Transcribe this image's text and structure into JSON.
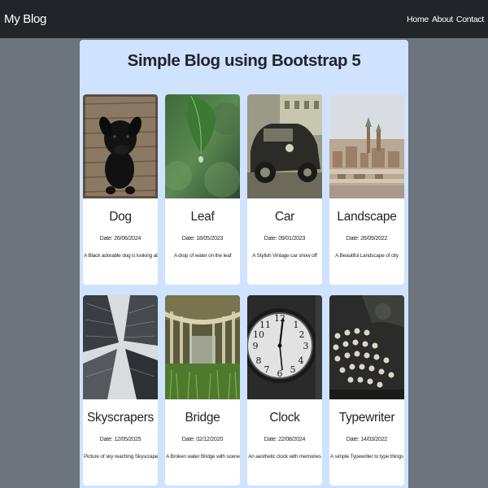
{
  "navbar": {
    "brand": "My Blog",
    "links": [
      {
        "label": "Home"
      },
      {
        "label": "About"
      },
      {
        "label": "Contact"
      }
    ]
  },
  "main": {
    "title": "Simple Blog using Bootstrap 5",
    "posts": [
      {
        "title": "Dog",
        "date": "Date: 26/06/2024",
        "description": "A Black adorable dog is looking at us",
        "image_icon": "dog-photo"
      },
      {
        "title": "Leaf",
        "date": "Date: 18/05/2023",
        "description": "A drop of water on the leaf",
        "image_icon": "leaf-photo"
      },
      {
        "title": "Car",
        "date": "Date: 09/01/2023",
        "description": "A Stylish Vintage car show off",
        "image_icon": "car-photo"
      },
      {
        "title": "Landscape",
        "date": "Date: 26/09/2022",
        "description": "A Beautiful Landscape of city",
        "image_icon": "landscape-photo"
      },
      {
        "title": "Skyscrapers",
        "date": "Date: 12/05/2025",
        "description": "Picture of sky reaching Skyscrapers",
        "image_icon": "skyscrapers-photo"
      },
      {
        "title": "Bridge",
        "date": "Date: 02/12/2020",
        "description": "A Broken water Bridge with scenery",
        "image_icon": "bridge-photo"
      },
      {
        "title": "Clock",
        "date": "Date: 22/08/2024",
        "description": "An aesthetic clock with memories",
        "image_icon": "clock-photo"
      },
      {
        "title": "Typewriter",
        "date": "Date: 14/03/2022",
        "description": "A simple Typewriter to type things",
        "image_icon": "typewriter-photo"
      }
    ]
  },
  "colors": {
    "navbar_bg": "#212529",
    "page_bg": "#6c757d",
    "panel_bg": "#cfe2ff",
    "card_bg": "#ffffff"
  }
}
